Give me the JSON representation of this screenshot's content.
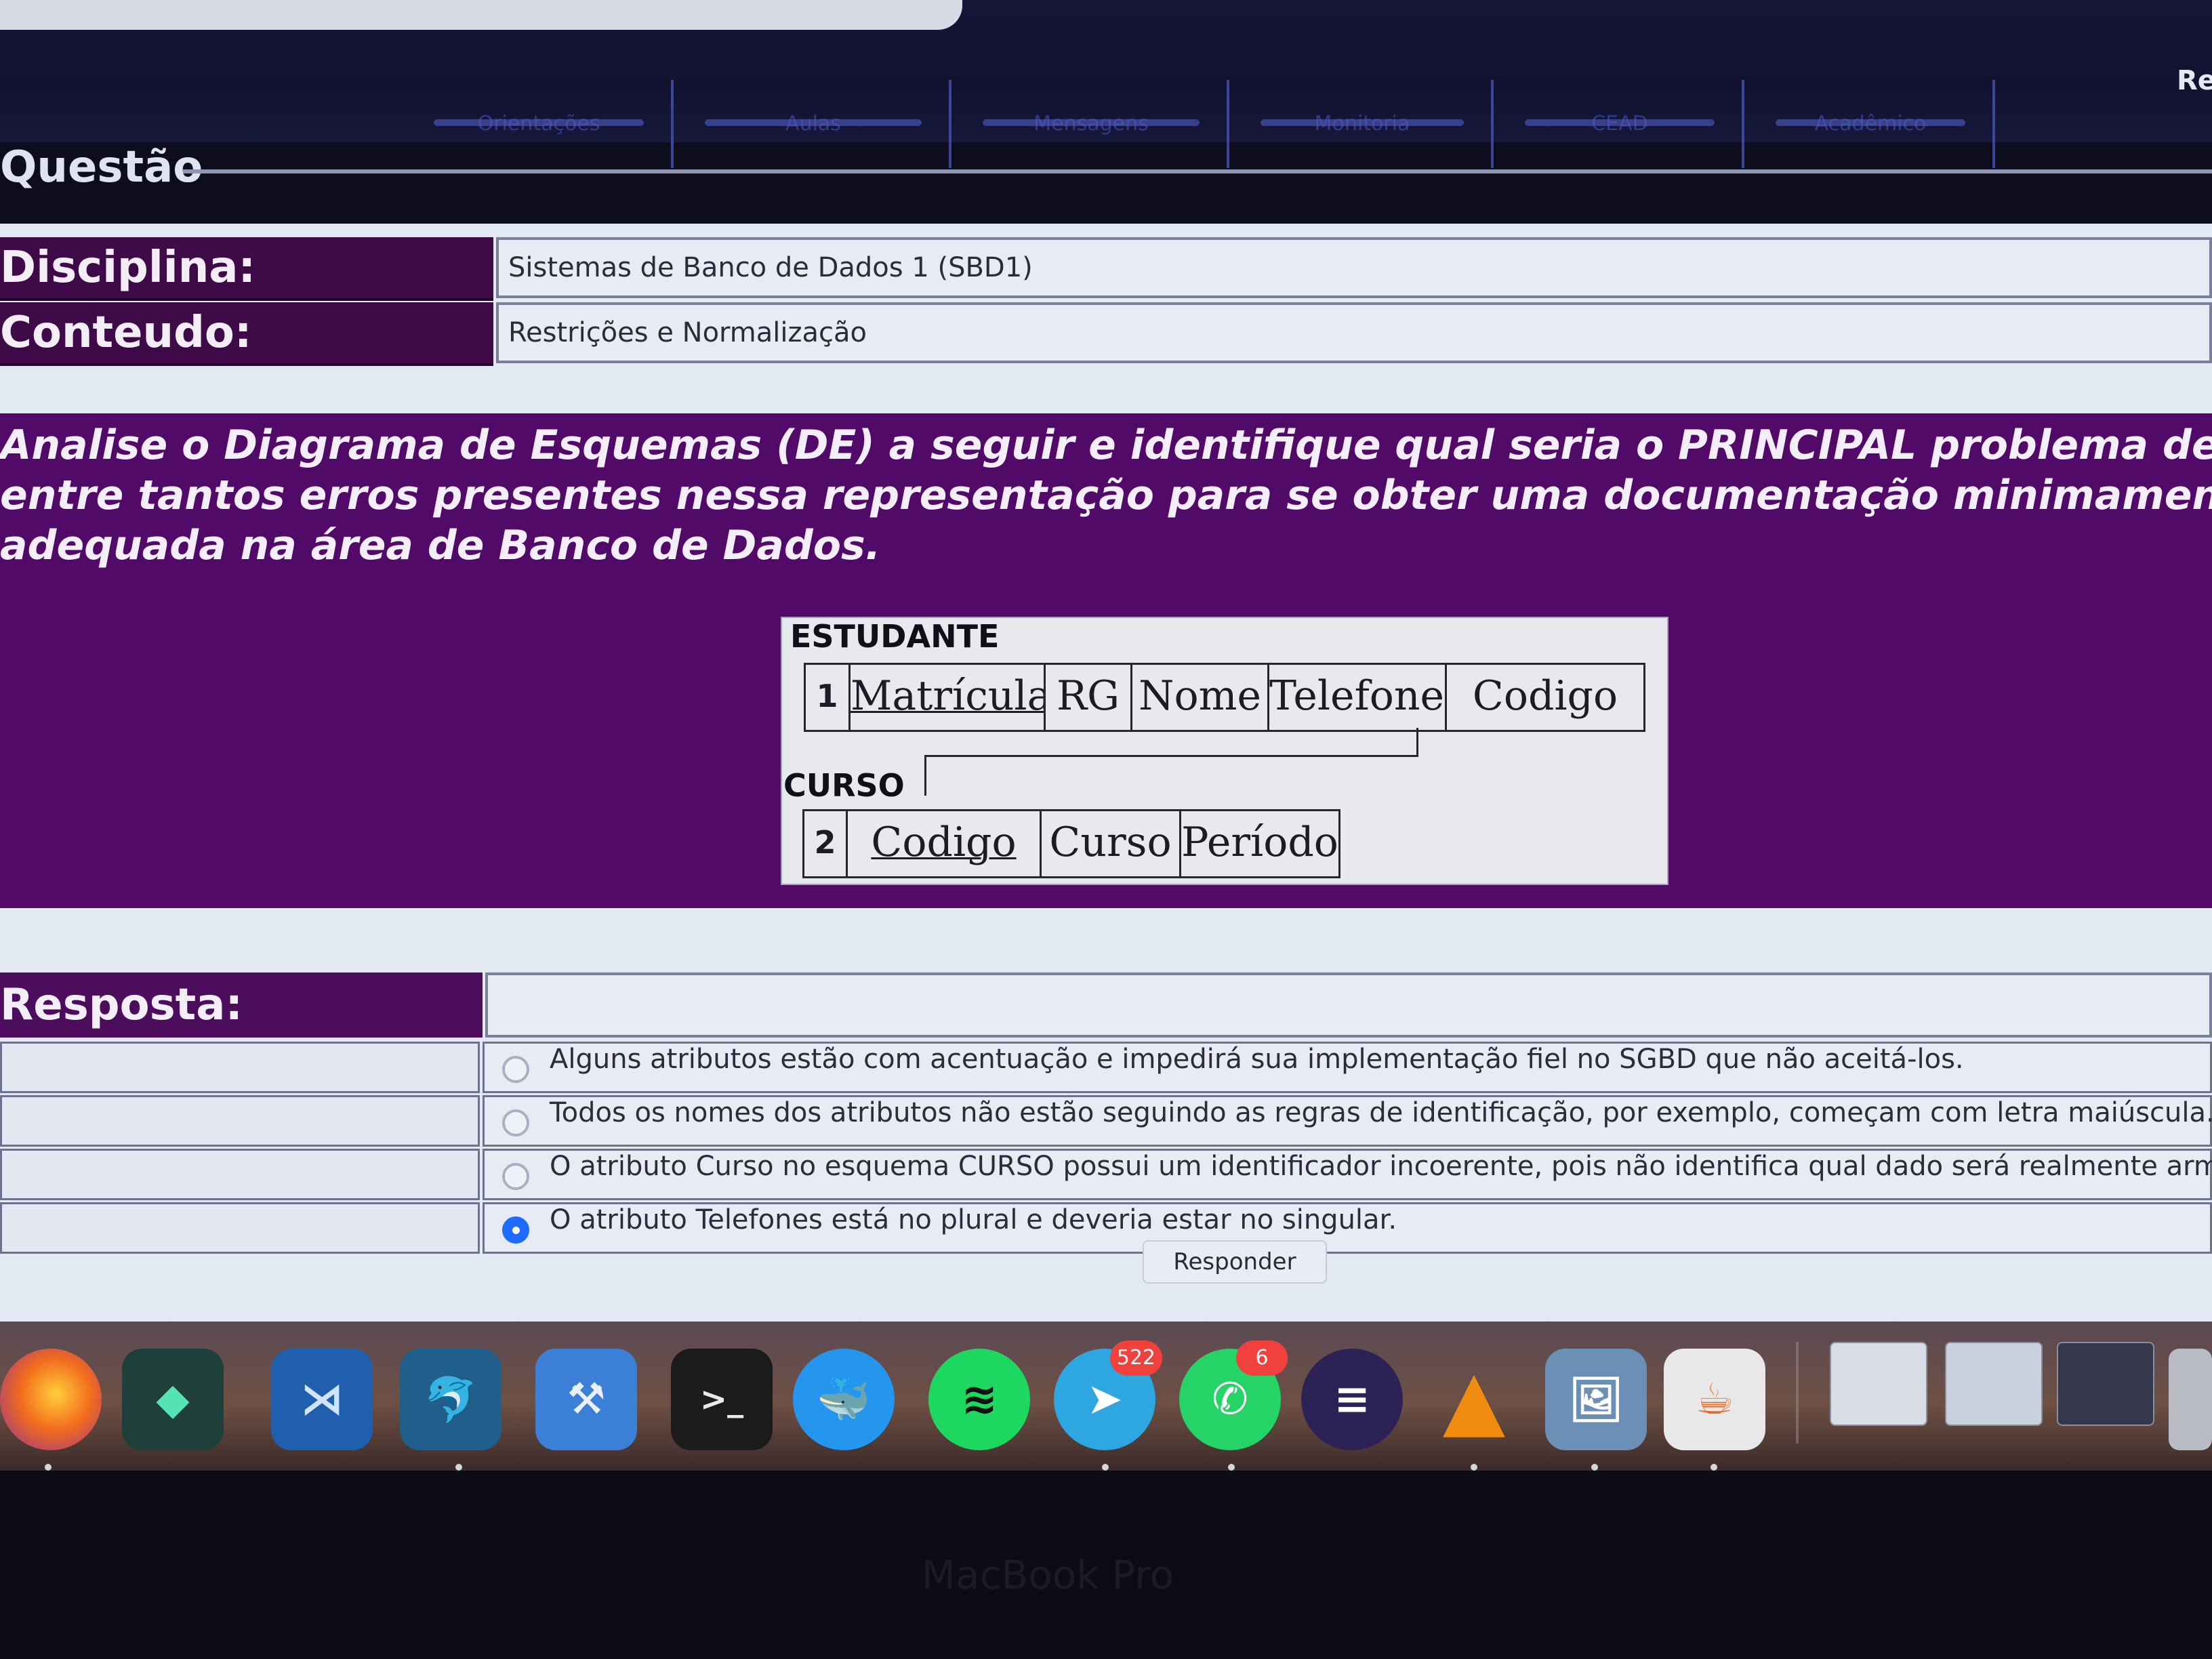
{
  "browser": {
    "corner_label": "Re"
  },
  "nav_tabs": [
    "Orientações",
    "Aulas",
    "Mensagens",
    "Monitoria",
    "CEAD",
    "Acadêmico"
  ],
  "page": {
    "section_title": "Questão"
  },
  "info": {
    "discipline_label": "Disciplina:",
    "discipline_value": "Sistemas de Banco de Dados 1 (SBD1)",
    "content_label": "Conteudo:",
    "content_value": "Restrições e Normalização"
  },
  "question": {
    "line1": "Analise o Diagrama de Esquemas (DE) a seguir e identifique qual seria o PRINCIPAL problema desse diagrama",
    "line2": "entre tantos erros presentes nessa representação para se obter uma documentação minimamente coerente e",
    "line3": "adequada na área de Banco de Dados."
  },
  "diagram": {
    "estudante": {
      "title": "ESTUDANTE",
      "number": "1",
      "attributes": [
        "Matrícula",
        "RG",
        "Nome",
        "Telefones",
        "Codigo"
      ]
    },
    "curso": {
      "title": "CURSO",
      "number": "2",
      "attributes": [
        "Codigo",
        "Curso",
        "Período"
      ]
    }
  },
  "answer": {
    "label": "Resposta:",
    "options": [
      {
        "text": "Alguns atributos estão com acentuação e impedirá sua implementação fiel no SGBD que não aceitá-los.",
        "selected": false
      },
      {
        "text": "Todos os nomes dos atributos não estão seguindo as regras de identificação, por exemplo, começam com letra maiúscula.",
        "selected": false
      },
      {
        "text": "O atributo Curso no esquema CURSO possui um identificador incoerente, pois não identifica qual dado será realmente armazenado.",
        "selected": false
      },
      {
        "text": "O atributo Telefones está no plural e deveria estar no singular.",
        "selected": true
      }
    ],
    "submit_label": "Responder"
  },
  "dock": {
    "apps": [
      {
        "name": "firefox-icon",
        "color": "#f26b1d"
      },
      {
        "name": "filmora-icon",
        "color": "#1f3f3b"
      },
      {
        "name": "vscode-icon",
        "color": "#1f5fae"
      },
      {
        "name": "mysql-workbench-icon",
        "color": "#205f8c"
      },
      {
        "name": "xcode-icon",
        "color": "#3b7fd6"
      },
      {
        "name": "terminal-icon",
        "color": "#1b1b1b"
      },
      {
        "name": "docker-icon",
        "color": "#2496ed"
      },
      {
        "name": "spotify-icon",
        "color": "#1ed760"
      },
      {
        "name": "telegram-icon",
        "color": "#2ea6e0",
        "badge": "522"
      },
      {
        "name": "whatsapp-icon",
        "color": "#25d366",
        "badge": "6"
      },
      {
        "name": "eclipse-icon",
        "color": "#2c2255"
      },
      {
        "name": "vlc-icon",
        "color": "#f28c10"
      },
      {
        "name": "preview-icon",
        "color": "#6c8fb5"
      },
      {
        "name": "java-icon",
        "color": "#e8e8e8"
      }
    ]
  },
  "bezel": {
    "label": "MacBook Pro"
  }
}
